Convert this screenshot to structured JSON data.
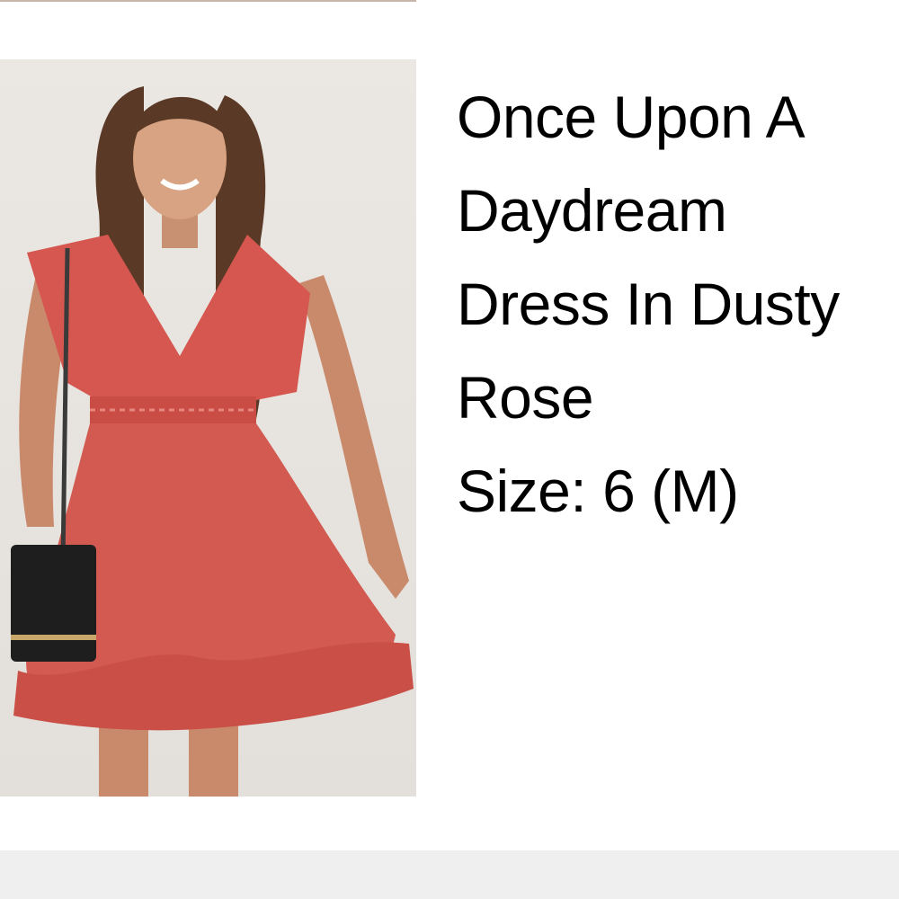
{
  "product": {
    "title": "Once Upon A Daydream Dress In Dusty Rose",
    "size": "Size: 6 (M)",
    "image_label": "model wearing dusty rose mini dress with black crossbody bag"
  },
  "colors": {
    "dress": "#d5574f",
    "background": "#e6e2de",
    "bottom_bar": "#efefef"
  },
  "bottom_bar": {
    "text": ""
  }
}
